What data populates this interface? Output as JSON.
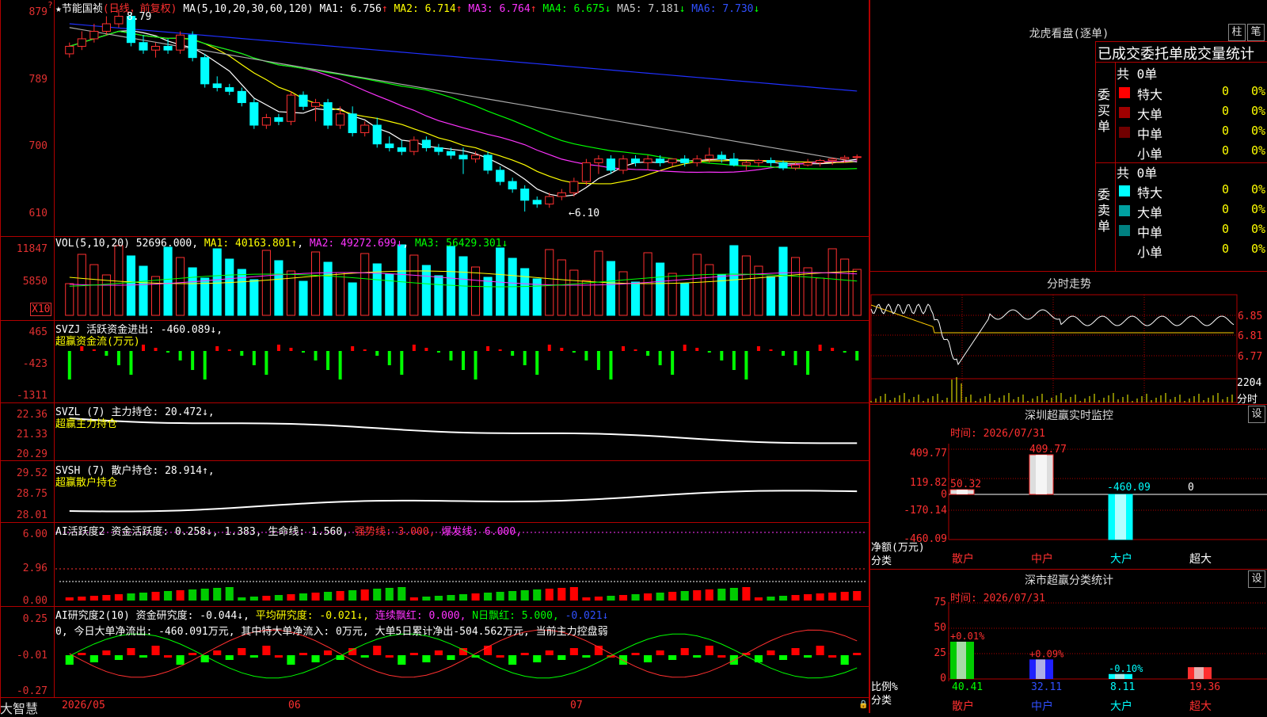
{
  "stock": {
    "name": "节能国祯",
    "period": "(日线，前复权)",
    "ma_label": "MA(5,10,20,30,60,120)",
    "ma": [
      {
        "k": "MA1:",
        "v": "6.756",
        "a": "↑",
        "c": "#ffffff"
      },
      {
        "k": "MA2:",
        "v": "6.714",
        "a": "↑",
        "c": "#ffff00"
      },
      {
        "k": "MA3:",
        "v": "6.764",
        "a": "↑",
        "c": "#ff33ff"
      },
      {
        "k": "MA4:",
        "v": "6.675",
        "a": "↓",
        "c": "#00ff00"
      },
      {
        "k": "MA5:",
        "v": "7.181",
        "a": "↓",
        "c": "#cccccc"
      },
      {
        "k": "MA6:",
        "v": "7.730",
        "a": "↓",
        "c": "#3050ff"
      }
    ],
    "high_mark": "8.79",
    "low_mark": "←6.10",
    "marker_q": "?"
  },
  "price_axis": [
    "879",
    "789",
    "700",
    "610"
  ],
  "vol": {
    "label": "VOL(5,10,20)",
    "v": "52696.000",
    "ma1": "MA1: 40163.801↑",
    "ma2": "MA2: 49272.699↓",
    "ma3": "MA3: 56429.301↓",
    "axis": [
      "11847",
      "5850"
    ],
    "unit": "X10"
  },
  "svzj": {
    "label": "SVZJ",
    "text": "活跃资金进出: -460.089↓,",
    "sub": "超赢资金流(万元)",
    "axis": [
      "465",
      "-423",
      "-1311"
    ]
  },
  "svzl": {
    "label": "SVZL (7)",
    "text": "主力持仓: 20.472↓,",
    "sub": "超赢主力持仓",
    "axis": [
      "22.36",
      "21.33",
      "20.29"
    ]
  },
  "svsh": {
    "label": "SVSH (7)",
    "text": "散户持仓: 28.914↑,",
    "sub": "超赢散户持仓",
    "axis": [
      "29.52",
      "28.75",
      "28.01"
    ]
  },
  "ai1": {
    "label": "AI活跃度2",
    "text": "资金活跃度: 0.258↓, 1.383,",
    "life": "生命线: 1.560,",
    "strong": "强势线: 3.000,",
    "burst": "爆发线: 6.000,",
    "axis": [
      "6.00",
      "2.96",
      "0.00"
    ]
  },
  "ai2": {
    "label": "AI研究度2(10)",
    "t1": "资金研究度: -0.044↓,",
    "t2": "平均研究度: -0.021↓,",
    "t3": "连续飘红: 0.000,",
    "t4": "N日飘红: 5.000,",
    "t5": "-0.021↓",
    "note": "0, 今日大单净流出: -460.091万元, 其中特大单净流入: 0万元, 大单5日累计净出-504.562万元, 当前主力控盘弱",
    "axis": [
      "0.25",
      "-0.01",
      "-0.27"
    ]
  },
  "dates": [
    "2026/05",
    "06",
    "07"
  ],
  "brand": "大智慧",
  "right": {
    "lh_title": "龙虎看盘(逐单)",
    "btn1": "柱",
    "btn2": "笔",
    "stat_title": "已成交委托单成交量统计",
    "buy": {
      "total": "共 0单",
      "side": "委买单",
      "rows": [
        {
          "n": "特大",
          "v": "0",
          "p": "0%",
          "c": "#ff0000"
        },
        {
          "n": "大单",
          "v": "0",
          "p": "0%",
          "c": "#a00000"
        },
        {
          "n": "中单",
          "v": "0",
          "p": "0%",
          "c": "#700000"
        },
        {
          "n": "小单",
          "v": "0",
          "p": "0%",
          "c": "#000000"
        }
      ]
    },
    "sell": {
      "total": "共 0单",
      "side": "委卖单",
      "rows": [
        {
          "n": "特大",
          "v": "0",
          "p": "0%",
          "c": "#00ffff"
        },
        {
          "n": "大单",
          "v": "0",
          "p": "0%",
          "c": "#00a0a0"
        },
        {
          "n": "中单",
          "v": "0",
          "p": "0%",
          "c": "#008080"
        },
        {
          "n": "小单",
          "v": "0",
          "p": "0%",
          "c": "#000000"
        }
      ]
    },
    "fs_title": "分时走势",
    "fs_axis": [
      "6.85",
      "6.81",
      "6.77"
    ],
    "fs_vol": "2204",
    "fs_vol_unit": "分时",
    "sz_title": "深圳超赢实时监控",
    "sz_btn": "设",
    "sz_time": "时间: 2026/07/31",
    "sz_axis": [
      "409.77",
      "119.82",
      "0",
      "-170.14",
      "-460.09"
    ],
    "sz_left": "净额(万元)",
    "sz_left2": "分类",
    "sz_cats": [
      "散户",
      "中户",
      "大户",
      "超大"
    ],
    "sz_vals": [
      "50.32",
      "409.77",
      "-460.09",
      "0"
    ],
    "ss_title": "深市超赢分类统计",
    "ss_btn": "设",
    "ss_time": "时间: 2026/07/31",
    "ss_axis": [
      "75",
      "50",
      "25",
      "0"
    ],
    "ss_left": "比例%",
    "ss_left2": "分类",
    "ss_cats": [
      "散户",
      "中户",
      "大户",
      "超大"
    ],
    "ss_pct": [
      "+0.01%",
      "+0.09%",
      "-0.10%",
      ""
    ],
    "ss_vals": [
      "40.41",
      "32.11",
      "8.11",
      "19.36"
    ]
  },
  "chart_data": [
    {
      "type": "candlestick",
      "title": "节能国祯",
      "ylim": [
        6.1,
        8.79
      ],
      "ohlc": [
        [
          8.2,
          8.35,
          8.15,
          8.3
        ],
        [
          8.3,
          8.5,
          8.25,
          8.4
        ],
        [
          8.4,
          8.6,
          8.35,
          8.5
        ],
        [
          8.5,
          8.7,
          8.45,
          8.6
        ],
        [
          8.6,
          8.79,
          8.55,
          8.7
        ],
        [
          8.7,
          8.75,
          8.3,
          8.35
        ],
        [
          8.35,
          8.45,
          8.2,
          8.25
        ],
        [
          8.25,
          8.35,
          8.15,
          8.3
        ],
        [
          8.3,
          8.4,
          8.2,
          8.25
        ],
        [
          8.25,
          8.5,
          8.2,
          8.45
        ],
        [
          8.45,
          8.5,
          8.1,
          8.15
        ],
        [
          8.15,
          8.2,
          7.75,
          7.8
        ],
        [
          7.8,
          7.9,
          7.7,
          7.75
        ],
        [
          7.75,
          7.8,
          7.65,
          7.7
        ],
        [
          7.7,
          7.75,
          7.5,
          7.55
        ],
        [
          7.55,
          7.6,
          7.2,
          7.25
        ],
        [
          7.25,
          7.4,
          7.2,
          7.35
        ],
        [
          7.35,
          7.4,
          7.25,
          7.3
        ],
        [
          7.3,
          7.7,
          7.25,
          7.65
        ],
        [
          7.65,
          7.7,
          7.45,
          7.5
        ],
        [
          7.5,
          7.6,
          7.3,
          7.55
        ],
        [
          7.55,
          7.6,
          7.2,
          7.25
        ],
        [
          7.25,
          7.5,
          7.2,
          7.4
        ],
        [
          7.4,
          7.5,
          7.1,
          7.15
        ],
        [
          7.15,
          7.3,
          7.1,
          7.25
        ],
        [
          7.25,
          7.35,
          6.95,
          7.0
        ],
        [
          7.0,
          7.1,
          6.9,
          6.95
        ],
        [
          6.95,
          7.05,
          6.85,
          6.9
        ],
        [
          6.9,
          7.1,
          6.85,
          7.05
        ],
        [
          7.05,
          7.1,
          6.9,
          6.95
        ],
        [
          6.95,
          7.0,
          6.85,
          6.9
        ],
        [
          6.9,
          6.95,
          6.8,
          6.85
        ],
        [
          6.85,
          6.95,
          6.6,
          6.8
        ],
        [
          6.8,
          6.9,
          6.75,
          6.85
        ],
        [
          6.85,
          6.9,
          6.6,
          6.65
        ],
        [
          6.65,
          6.7,
          6.45,
          6.5
        ],
        [
          6.5,
          6.55,
          6.35,
          6.4
        ],
        [
          6.4,
          6.45,
          6.1,
          6.25
        ],
        [
          6.25,
          6.3,
          6.15,
          6.2
        ],
        [
          6.2,
          6.35,
          6.15,
          6.3
        ],
        [
          6.3,
          6.4,
          6.25,
          6.35
        ],
        [
          6.35,
          6.55,
          6.3,
          6.5
        ],
        [
          6.5,
          6.8,
          6.45,
          6.75
        ],
        [
          6.75,
          6.85,
          6.6,
          6.8
        ],
        [
          6.8,
          6.85,
          6.6,
          6.65
        ],
        [
          6.65,
          6.85,
          6.6,
          6.8
        ],
        [
          6.8,
          6.85,
          6.7,
          6.75
        ],
        [
          6.75,
          6.85,
          6.65,
          6.8
        ],
        [
          6.8,
          6.85,
          6.7,
          6.75
        ],
        [
          6.75,
          6.8,
          6.7,
          6.8
        ],
        [
          6.8,
          6.85,
          6.7,
          6.75
        ],
        [
          6.75,
          6.85,
          6.7,
          6.8
        ],
        [
          6.8,
          6.95,
          6.75,
          6.85
        ],
        [
          6.85,
          6.9,
          6.75,
          6.8
        ],
        [
          6.8,
          6.88,
          6.7,
          6.72
        ],
        [
          6.72,
          6.78,
          6.65,
          6.75
        ],
        [
          6.75,
          6.8,
          6.7,
          6.78
        ],
        [
          6.78,
          6.82,
          6.7,
          6.75
        ],
        [
          6.75,
          6.78,
          6.65,
          6.68
        ],
        [
          6.68,
          6.75,
          6.65,
          6.72
        ],
        [
          6.72,
          6.8,
          6.7,
          6.75
        ],
        [
          6.75,
          6.8,
          6.7,
          6.78
        ],
        [
          6.78,
          6.82,
          6.72,
          6.8
        ],
        [
          6.8,
          6.85,
          6.75,
          6.82
        ],
        [
          6.82,
          6.86,
          6.78,
          6.83
        ]
      ]
    },
    {
      "type": "bar",
      "title": "VOL(5,10,20)",
      "ylim": [
        0,
        11847
      ]
    },
    {
      "type": "bar",
      "title": "SVZJ",
      "ylim": [
        -1311,
        465
      ]
    },
    {
      "type": "line",
      "title": "SVZL (7)",
      "ylim": [
        20.29,
        22.36
      ]
    },
    {
      "type": "line",
      "title": "SVSH (7)",
      "ylim": [
        28.01,
        29.52
      ]
    },
    {
      "type": "bar",
      "title": "AI活跃度2",
      "ylim": [
        0,
        6
      ]
    },
    {
      "type": "bar",
      "title": "AI研究度2(10)",
      "ylim": [
        -0.27,
        0.25
      ]
    },
    {
      "type": "bar",
      "title": "深圳超赢实时监控",
      "categories": [
        "散户",
        "中户",
        "大户",
        "超大"
      ],
      "values": [
        50.32,
        409.77,
        -460.09,
        0
      ],
      "ylim": [
        -460.09,
        409.77
      ]
    },
    {
      "type": "bar",
      "title": "深市超赢分类统计",
      "categories": [
        "散户",
        "中户",
        "大户",
        "超大"
      ],
      "values": [
        40.41,
        32.11,
        8.11,
        19.36
      ],
      "ylim": [
        0,
        75
      ]
    }
  ]
}
